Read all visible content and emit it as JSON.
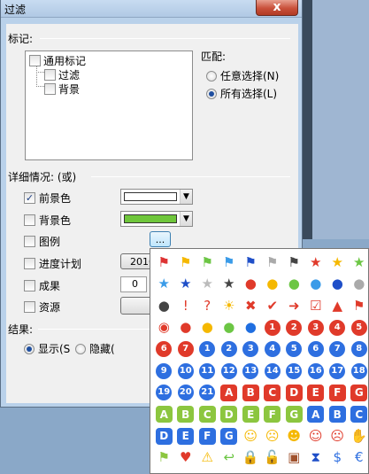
{
  "window": {
    "title": "过滤",
    "close_label": "x"
  },
  "tags": {
    "label": "标记:",
    "items": [
      {
        "label": "通用标记",
        "checked": false
      },
      {
        "label": "过滤",
        "checked": false
      },
      {
        "label": "背景",
        "checked": false
      }
    ]
  },
  "match": {
    "label": "匹配:",
    "options": [
      {
        "label": "任意选择(N)",
        "selected": false
      },
      {
        "label": "所有选择(L)",
        "selected": true
      }
    ]
  },
  "details": {
    "label": "详细情况: (或)",
    "rows": [
      {
        "label": "前景色",
        "checked": true,
        "control": "color",
        "color": "#ffffff"
      },
      {
        "label": "背景色",
        "checked": false,
        "control": "color",
        "color": "#6fc63b"
      },
      {
        "label": "图例",
        "checked": false,
        "control": "button",
        "value": "..."
      },
      {
        "label": "进度计划",
        "checked": false,
        "control": "button",
        "value": "2016"
      },
      {
        "label": "成果",
        "checked": false,
        "control": "number",
        "value": "0"
      },
      {
        "label": "资源",
        "checked": false,
        "control": "button",
        "value": ""
      }
    ]
  },
  "result": {
    "label": "结果:",
    "options": [
      {
        "label": "显示(S",
        "selected": true
      },
      {
        "label": "隐藏(",
        "selected": false
      }
    ]
  },
  "legend_popup": {
    "icons": [
      {
        "g": "⚑",
        "color": "#d33"
      },
      {
        "g": "⚑",
        "color": "#f5b800"
      },
      {
        "g": "⚑",
        "color": "#6cc644"
      },
      {
        "g": "⚑",
        "color": "#3a9be8"
      },
      {
        "g": "⚑",
        "color": "#1f4fc8"
      },
      {
        "g": "⚑",
        "color": "#aaaaaa"
      },
      {
        "g": "⚑",
        "color": "#444444"
      },
      {
        "g": "★",
        "color": "#e03a2a"
      },
      {
        "g": "★",
        "color": "#f5b800"
      },
      {
        "g": "★",
        "color": "#6cc644"
      },
      {
        "g": "★",
        "color": "#3a9be8"
      },
      {
        "g": "★",
        "color": "#1f4fc8"
      },
      {
        "g": "★",
        "color": "#bbbbbb"
      },
      {
        "g": "★",
        "color": "#444444"
      },
      {
        "g": "●",
        "color": "#e03a2a"
      },
      {
        "g": "●",
        "color": "#f5b800"
      },
      {
        "g": "●",
        "color": "#6cc644"
      },
      {
        "g": "●",
        "color": "#3a9be8"
      },
      {
        "g": "●",
        "color": "#1f4fc8"
      },
      {
        "g": "●",
        "color": "#aaaaaa"
      },
      {
        "g": "●",
        "color": "#444444"
      },
      {
        "g": "!",
        "color": "#e03a2a"
      },
      {
        "g": "?",
        "color": "#e03a2a"
      },
      {
        "g": "☀",
        "color": "#f5b800"
      },
      {
        "g": "✖",
        "color": "#e03a2a"
      },
      {
        "g": "✔",
        "color": "#e03a2a"
      },
      {
        "g": "➜",
        "color": "#e03a2a"
      },
      {
        "g": "☑",
        "color": "#e03a2a"
      },
      {
        "g": "▲",
        "color": "#e03a2a"
      },
      {
        "g": "⚑",
        "color": "#e03a2a"
      },
      {
        "g": "◉",
        "color": "#e03a2a"
      },
      {
        "g": "●",
        "color": "#e03a2a"
      },
      {
        "g": "●",
        "color": "#f5b800"
      },
      {
        "g": "●",
        "color": "#6cc644"
      },
      {
        "g": "●",
        "color": "#1f6ee0"
      },
      {
        "t": "1",
        "color": "#e03a2a",
        "shape": "c"
      },
      {
        "t": "2",
        "color": "#e03a2a",
        "shape": "c"
      },
      {
        "t": "3",
        "color": "#e03a2a",
        "shape": "c"
      },
      {
        "t": "4",
        "color": "#e03a2a",
        "shape": "c"
      },
      {
        "t": "5",
        "color": "#e03a2a",
        "shape": "c"
      },
      {
        "t": "6",
        "color": "#e03a2a",
        "shape": "c"
      },
      {
        "t": "7",
        "color": "#e03a2a",
        "shape": "c"
      },
      {
        "t": "1",
        "color": "#2e6fe0",
        "shape": "c"
      },
      {
        "t": "2",
        "color": "#2e6fe0",
        "shape": "c"
      },
      {
        "t": "3",
        "color": "#2e6fe0",
        "shape": "c"
      },
      {
        "t": "4",
        "color": "#2e6fe0",
        "shape": "c"
      },
      {
        "t": "5",
        "color": "#2e6fe0",
        "shape": "c"
      },
      {
        "t": "6",
        "color": "#2e6fe0",
        "shape": "c"
      },
      {
        "t": "7",
        "color": "#2e6fe0",
        "shape": "c"
      },
      {
        "t": "8",
        "color": "#2e6fe0",
        "shape": "c"
      },
      {
        "t": "9",
        "color": "#2e6fe0",
        "shape": "c"
      },
      {
        "t": "10",
        "color": "#2e6fe0",
        "shape": "c"
      },
      {
        "t": "11",
        "color": "#2e6fe0",
        "shape": "c"
      },
      {
        "t": "12",
        "color": "#2e6fe0",
        "shape": "c"
      },
      {
        "t": "13",
        "color": "#2e6fe0",
        "shape": "c"
      },
      {
        "t": "14",
        "color": "#2e6fe0",
        "shape": "c"
      },
      {
        "t": "15",
        "color": "#2e6fe0",
        "shape": "c"
      },
      {
        "t": "16",
        "color": "#2e6fe0",
        "shape": "c"
      },
      {
        "t": "17",
        "color": "#2e6fe0",
        "shape": "c"
      },
      {
        "t": "18",
        "color": "#2e6fe0",
        "shape": "c"
      },
      {
        "t": "19",
        "color": "#2e6fe0",
        "shape": "c"
      },
      {
        "t": "20",
        "color": "#2e6fe0",
        "shape": "c"
      },
      {
        "t": "21",
        "color": "#2e6fe0",
        "shape": "c"
      },
      {
        "t": "A",
        "color": "#e03a2a",
        "shape": "s"
      },
      {
        "t": "B",
        "color": "#e03a2a",
        "shape": "s"
      },
      {
        "t": "C",
        "color": "#e03a2a",
        "shape": "s"
      },
      {
        "t": "D",
        "color": "#e03a2a",
        "shape": "s"
      },
      {
        "t": "E",
        "color": "#e03a2a",
        "shape": "s"
      },
      {
        "t": "F",
        "color": "#e03a2a",
        "shape": "s"
      },
      {
        "t": "G",
        "color": "#e03a2a",
        "shape": "s"
      },
      {
        "t": "A",
        "color": "#8cc63f",
        "shape": "s"
      },
      {
        "t": "B",
        "color": "#8cc63f",
        "shape": "s"
      },
      {
        "t": "C",
        "color": "#8cc63f",
        "shape": "s"
      },
      {
        "t": "D",
        "color": "#8cc63f",
        "shape": "s"
      },
      {
        "t": "E",
        "color": "#8cc63f",
        "shape": "s"
      },
      {
        "t": "F",
        "color": "#8cc63f",
        "shape": "s"
      },
      {
        "t": "G",
        "color": "#8cc63f",
        "shape": "s"
      },
      {
        "t": "A",
        "color": "#2e6fe0",
        "shape": "s"
      },
      {
        "t": "B",
        "color": "#2e6fe0",
        "shape": "s"
      },
      {
        "t": "C",
        "color": "#2e6fe0",
        "shape": "s"
      },
      {
        "t": "D",
        "color": "#2e6fe0",
        "shape": "s"
      },
      {
        "t": "E",
        "color": "#2e6fe0",
        "shape": "s"
      },
      {
        "t": "F",
        "color": "#2e6fe0",
        "shape": "s"
      },
      {
        "t": "G",
        "color": "#2e6fe0",
        "shape": "s"
      },
      {
        "g": "☺",
        "color": "#f5b800"
      },
      {
        "g": "☹",
        "color": "#f5b800"
      },
      {
        "g": "☻",
        "color": "#f5b800"
      },
      {
        "g": "☺",
        "color": "#e03a2a"
      },
      {
        "g": "☹",
        "color": "#e03a2a"
      },
      {
        "g": "✋",
        "color": "#f5b800"
      },
      {
        "g": "⚑",
        "color": "#8cc63f"
      },
      {
        "g": "♥",
        "color": "#e03a2a"
      },
      {
        "g": "⚠",
        "color": "#f5b800"
      },
      {
        "g": "↩",
        "color": "#6cc644"
      },
      {
        "g": "🔒",
        "color": "#f5b800"
      },
      {
        "g": "🔓",
        "color": "#f5b800"
      },
      {
        "g": "▣",
        "color": "#a0522d"
      },
      {
        "g": "⧗",
        "color": "#1f4fc8"
      },
      {
        "g": "$",
        "color": "#2e6fe0"
      },
      {
        "g": "€",
        "color": "#2e6fe0"
      }
    ]
  }
}
